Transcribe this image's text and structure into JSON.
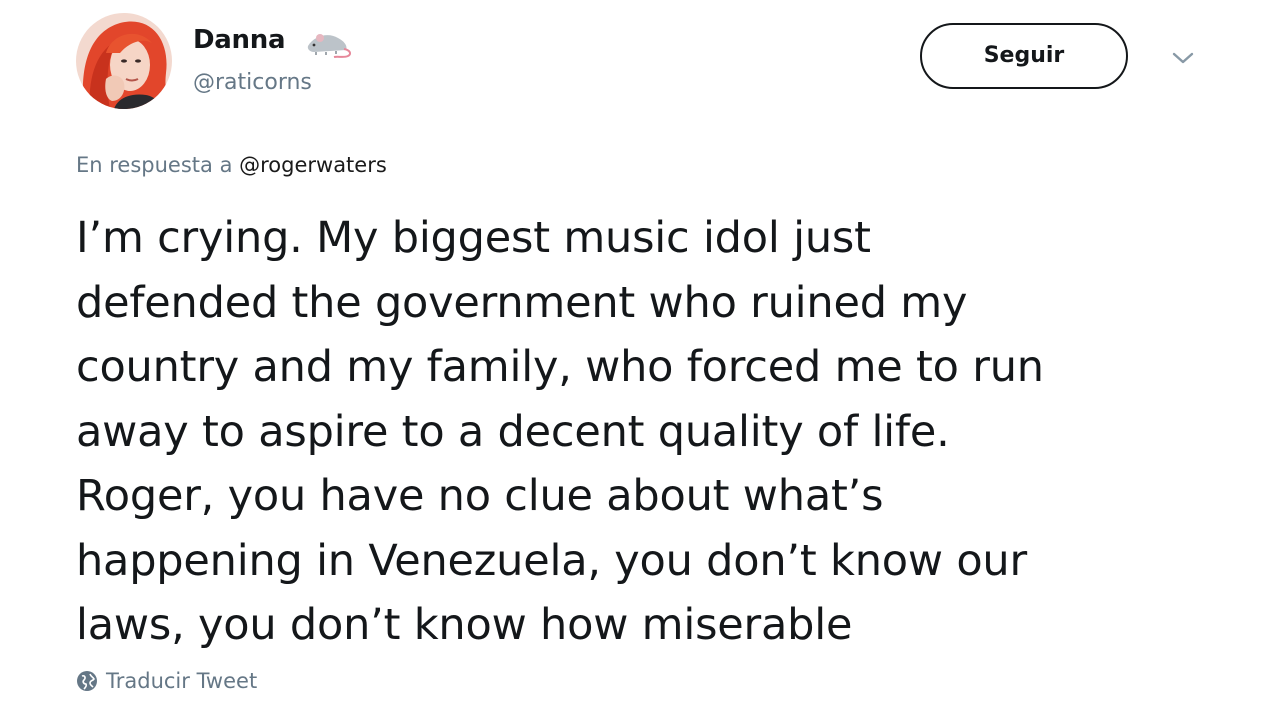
{
  "author": {
    "display_name": "Danna",
    "username": "@raticorns",
    "avatar_icon": "profile-photo-redhead"
  },
  "follow_button": {
    "label": "Seguir"
  },
  "reply_context": {
    "prefix": "En respuesta a ",
    "mention": "@rogerwaters"
  },
  "tweet": {
    "text": "I’m crying. My biggest music idol just\ndefended the government who ruined my\ncountry and my family, who forced me to run\naway to aspire to a decent quality of life.\nRoger, you have no clue about what’s\nhappening in Venezuela, you don’t know our\nlaws, you don’t know how miserable"
  },
  "translate": {
    "label": "Traducir Tweet",
    "icon": "globe-icon"
  },
  "colors": {
    "primary_text": "#14171a",
    "secondary_text": "#657786",
    "background": "#ffffff"
  }
}
